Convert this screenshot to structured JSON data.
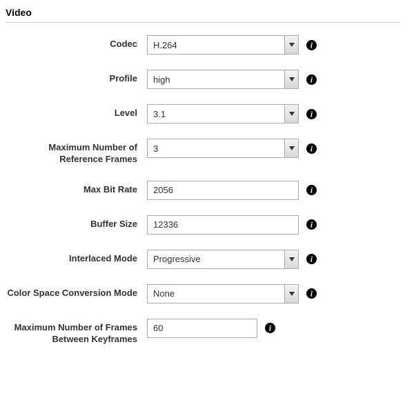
{
  "section": {
    "title": "Video"
  },
  "fields": {
    "codec": {
      "label": "Codec",
      "value": "H.264"
    },
    "profile": {
      "label": "Profile",
      "value": "high"
    },
    "level": {
      "label": "Level",
      "value": "3.1"
    },
    "max_ref_frames": {
      "label": "Maximum Number of Reference Frames",
      "value": "3"
    },
    "max_bit_rate": {
      "label": "Max Bit Rate",
      "value": "2056"
    },
    "buffer_size": {
      "label": "Buffer Size",
      "value": "12336"
    },
    "interlaced_mode": {
      "label": "Interlaced Mode",
      "value": "Progressive"
    },
    "color_space_mode": {
      "label": "Color Space Conversion Mode",
      "value": "None"
    },
    "max_frames_between_keyframes": {
      "label": "Maximum Number of Frames Between Keyframes",
      "value": "60"
    }
  }
}
